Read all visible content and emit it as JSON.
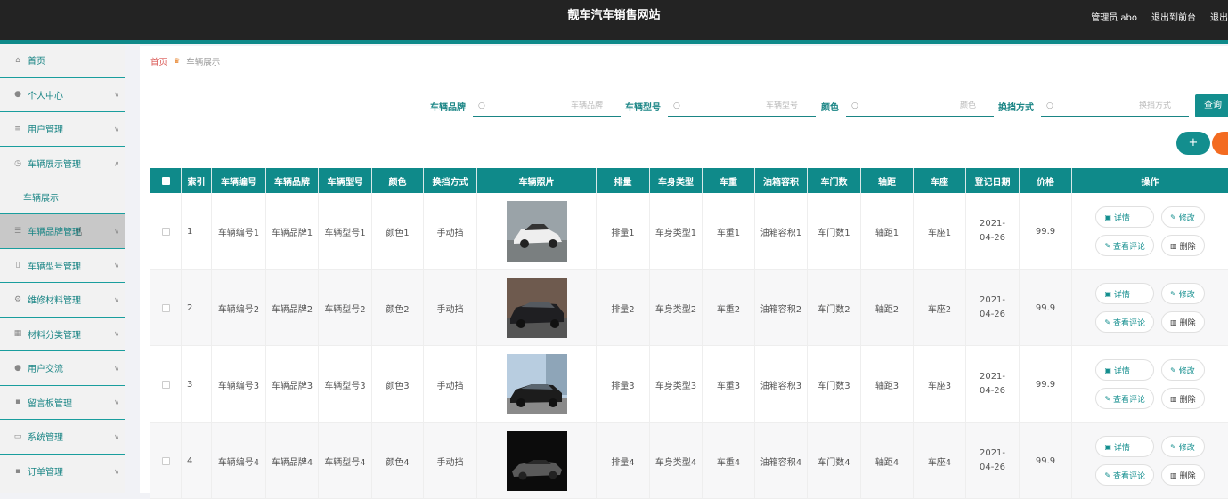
{
  "header": {
    "title": "靓车汽车销售网站",
    "admin": "管理员 abo",
    "back_front": "退出到前台",
    "logout": "退出"
  },
  "sidebar": {
    "items": [
      {
        "label": "首页",
        "icon": "home-icon",
        "has_chevron": false
      },
      {
        "label": "个人中心",
        "icon": "user-icon",
        "has_chevron": true
      },
      {
        "label": "用户管理",
        "icon": "list-icon",
        "has_chevron": true
      },
      {
        "label": "车辆展示管理",
        "icon": "clock-icon",
        "has_chevron": true,
        "expanded": true
      },
      {
        "label": "车辆展示",
        "sub": true
      },
      {
        "label": "车辆品牌管理",
        "icon": "sliders-icon",
        "has_chevron": true,
        "hover": true
      },
      {
        "label": "车辆型号管理",
        "icon": "tag-icon",
        "has_chevron": true
      },
      {
        "label": "维修材料管理",
        "icon": "gear-icon",
        "has_chevron": true
      },
      {
        "label": "材料分类管理",
        "icon": "grid-icon",
        "has_chevron": true
      },
      {
        "label": "用户交流",
        "icon": "person-icon",
        "has_chevron": true
      },
      {
        "label": "留言板管理",
        "icon": "board-icon",
        "has_chevron": true
      },
      {
        "label": "系统管理",
        "icon": "system-icon",
        "has_chevron": true
      },
      {
        "label": "订单管理",
        "icon": "order-icon",
        "has_chevron": true
      }
    ]
  },
  "breadcrumb": {
    "home": "首页",
    "current": "车辆展示"
  },
  "search": {
    "brand_label": "车辆品牌",
    "brand_placeholder": "车辆品牌",
    "model_label": "车辆型号",
    "model_placeholder": "车辆型号",
    "color_label": "颜色",
    "color_placeholder": "颜色",
    "gear_label": "换挡方式",
    "gear_placeholder": "换挡方式",
    "query": "查询"
  },
  "actions": {
    "add": "+"
  },
  "table": {
    "headers": [
      "",
      "索引",
      "车辆编号",
      "车辆品牌",
      "车辆型号",
      "颜色",
      "换挡方式",
      "车辆照片",
      "排量",
      "车身类型",
      "车重",
      "油箱容积",
      "车门数",
      "轴距",
      "车座",
      "登记日期",
      "价格",
      "操作"
    ],
    "rows": [
      {
        "idx": "1",
        "code": "车辆编号1",
        "brand": "车辆品牌1",
        "model": "车辆型号1",
        "color": "颜色1",
        "gear": "手动挡",
        "disp": "排量1",
        "body": "车身类型1",
        "weight": "车重1",
        "tank": "油箱容积1",
        "doors": "车门数1",
        "wheelbase": "轴距1",
        "seats": "车座1",
        "date": "2021-04-26",
        "price": "99.9"
      },
      {
        "idx": "2",
        "code": "车辆编号2",
        "brand": "车辆品牌2",
        "model": "车辆型号2",
        "color": "颜色2",
        "gear": "手动挡",
        "disp": "排量2",
        "body": "车身类型2",
        "weight": "车重2",
        "tank": "油箱容积2",
        "doors": "车门数2",
        "wheelbase": "轴距2",
        "seats": "车座2",
        "date": "2021-04-26",
        "price": "99.9"
      },
      {
        "idx": "3",
        "code": "车辆编号3",
        "brand": "车辆品牌3",
        "model": "车辆型号3",
        "color": "颜色3",
        "gear": "手动挡",
        "disp": "排量3",
        "body": "车身类型3",
        "weight": "车重3",
        "tank": "油箱容积3",
        "doors": "车门数3",
        "wheelbase": "轴距3",
        "seats": "车座3",
        "date": "2021-04-26",
        "price": "99.9"
      },
      {
        "idx": "4",
        "code": "车辆编号4",
        "brand": "车辆品牌4",
        "model": "车辆型号4",
        "color": "颜色4",
        "gear": "手动挡",
        "disp": "排量4",
        "body": "车身类型4",
        "weight": "车重4",
        "tank": "油箱容积4",
        "doors": "车门数4",
        "wheelbase": "轴距4",
        "seats": "车座4",
        "date": "2021-04-26",
        "price": "99.9"
      }
    ],
    "ops": {
      "detail": "详情",
      "edit": "修改",
      "comments": "查看评论",
      "delete": "删除"
    }
  },
  "colors": {
    "accent": "#0f8a8a",
    "header_bg": "#232323",
    "danger": "#f36b21"
  }
}
